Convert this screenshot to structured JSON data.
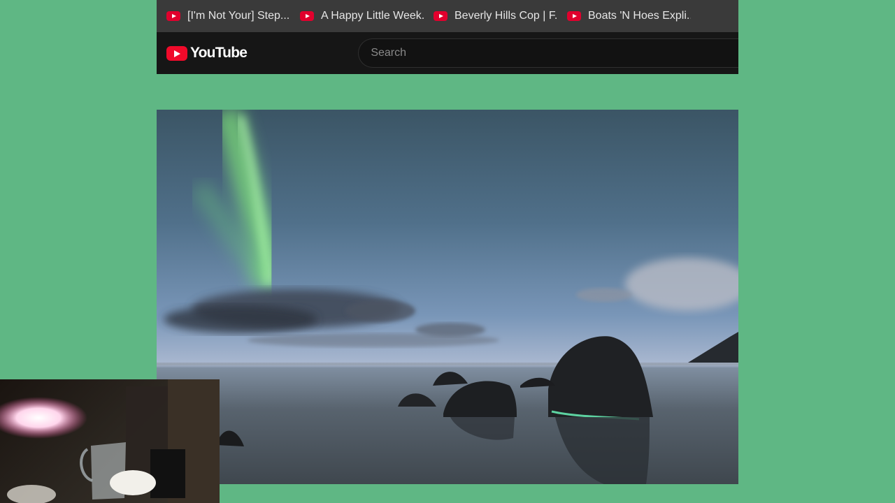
{
  "bookmarks": [
    {
      "label": "[I'm Not Your] Step...",
      "icon": "youtube-icon"
    },
    {
      "label": "A Happy Little Week...",
      "icon": "youtube-icon"
    },
    {
      "label": "Beverly Hills Cop | F...",
      "icon": "youtube-icon"
    },
    {
      "label": "Boats 'N Hoes Expli...",
      "icon": "youtube-icon"
    }
  ],
  "masthead": {
    "logo_text": "YouTube",
    "search_placeholder": "Search"
  },
  "colors": {
    "background": "#5fb784",
    "youtube_red": "#f00a2a",
    "masthead": "#161616",
    "bookmarks_bar": "#3a3a3a"
  }
}
